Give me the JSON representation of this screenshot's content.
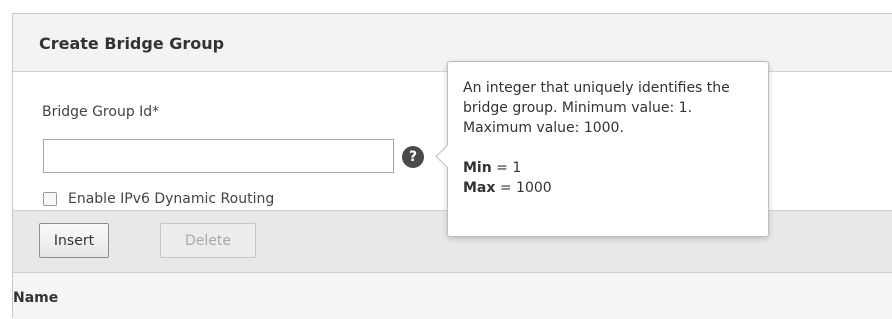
{
  "panel": {
    "title": "Create Bridge Group"
  },
  "form": {
    "bridge_group_id": {
      "label": "Bridge Group Id*",
      "value": "",
      "placeholder": ""
    },
    "enable_ipv6_routing": {
      "label": "Enable IPv6 Dynamic Routing",
      "checked": false
    }
  },
  "toolbar": {
    "insert_label": "Insert",
    "delete_label": "Delete"
  },
  "table": {
    "columns": [
      "Name"
    ]
  },
  "tooltip": {
    "description": "An integer that uniquely identifies the bridge group. Minimum value: 1. Maximum value: 1000.",
    "min_label": "Min",
    "min_value": "= 1",
    "max_label": "Max",
    "max_value": "= 1000"
  },
  "icons": {
    "help": "?"
  },
  "colors": {
    "header_bg": "#f3f3f3",
    "toolbar_bg": "#e8e8e8",
    "help_icon_bg": "#4a4a4a"
  }
}
